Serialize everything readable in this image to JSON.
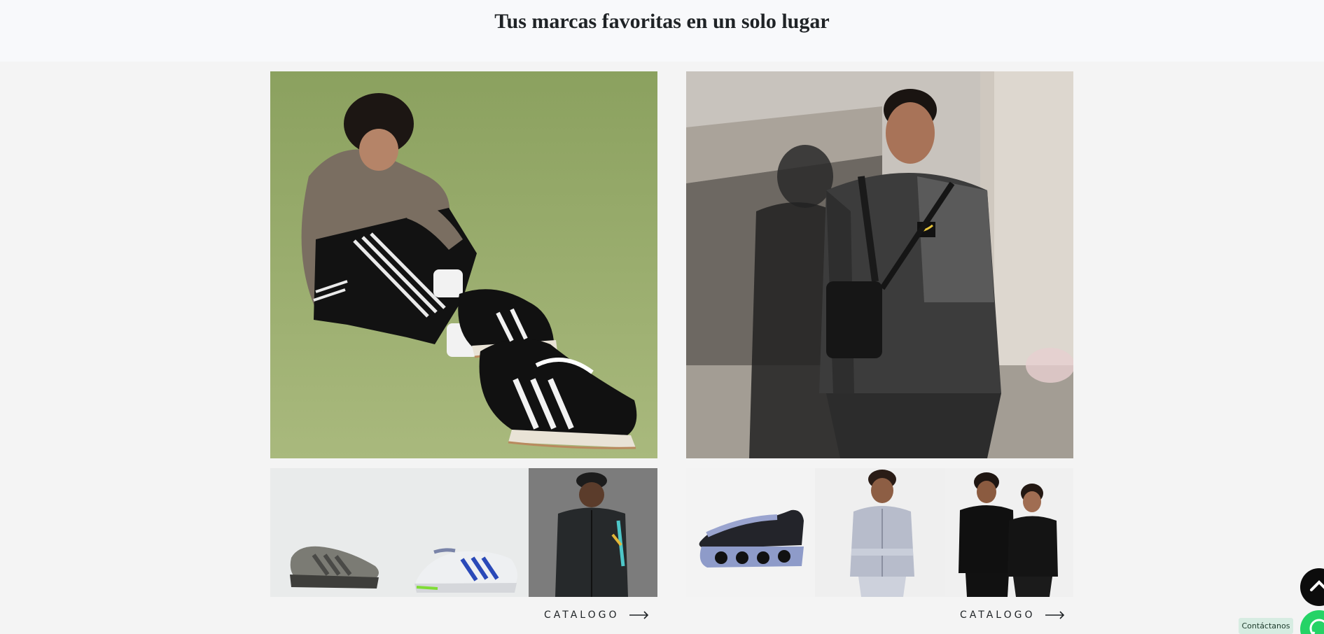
{
  "section": {
    "title": "Tus marcas favoritas en un solo lugar"
  },
  "brands": [
    {
      "hero_alt": "Modelo sentado con zapatillas Adidas Campus negras",
      "catalog_label": "CATALOGO"
    },
    {
      "hero_alt": "Modelo con chaqueta Nike gris",
      "catalog_label": "CATALOGO"
    }
  ],
  "floating": {
    "contact_label": "Contáctanos"
  },
  "colors": {
    "hero_adidas_bg": "#9aae6c",
    "whatsapp": "#25d366",
    "scroll_top": "#0c0c0c"
  }
}
